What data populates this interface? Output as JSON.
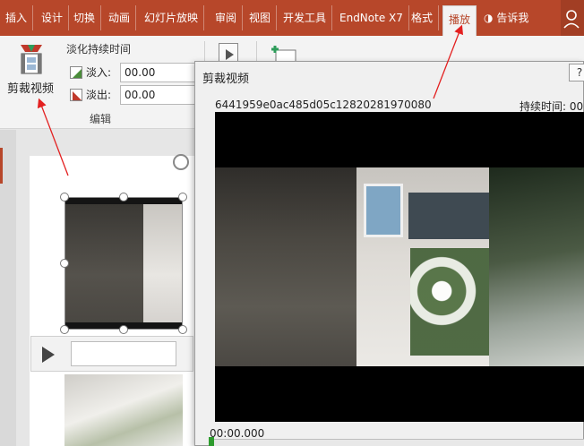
{
  "ribbon_tabs": [
    {
      "label": "插入"
    },
    {
      "label": "设计"
    },
    {
      "label": "切换"
    },
    {
      "label": "动画"
    },
    {
      "label": "幻灯片放映"
    },
    {
      "label": "审阅"
    },
    {
      "label": "视图"
    },
    {
      "label": "开发工具"
    },
    {
      "label": "EndNote X7"
    },
    {
      "label": "格式"
    },
    {
      "label": "播放"
    }
  ],
  "tell_me": "告诉我",
  "ribbon": {
    "trim_label": "剪裁视频",
    "fade_title": "淡化持续时间",
    "fade_in_label": "淡入:",
    "fade_in_value": "00.00",
    "fade_out_label": "淡出:",
    "fade_out_value": "00.00",
    "group_label": "编辑"
  },
  "dialog": {
    "title": "剪裁视频",
    "help": "?",
    "filename": "6441959e0ac485d05c12820281970080",
    "duration_label": "持续时间: 00",
    "current_time": "00:00.000"
  },
  "colors": {
    "accent": "#b7472a",
    "annotation": "#e32020"
  },
  "icons": {
    "trim": "film-trim-icon",
    "user": "user-icon",
    "bulb": "lightbulb-icon"
  }
}
